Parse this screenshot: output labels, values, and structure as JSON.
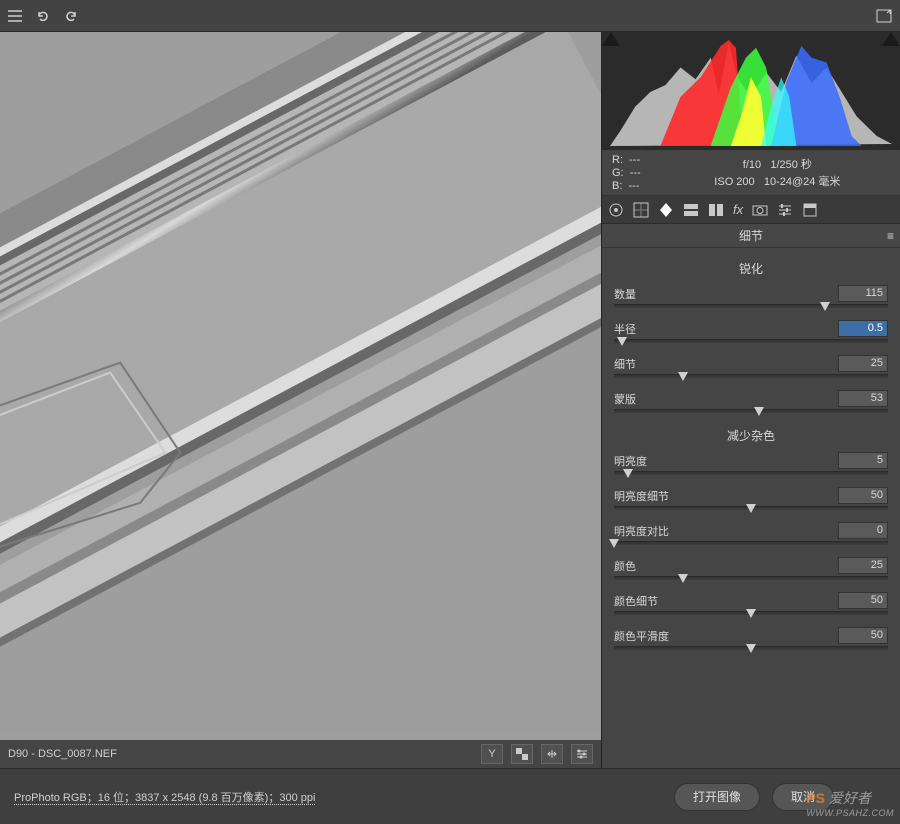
{
  "toolbar": {
    "icons": [
      "list-icon",
      "undo-icon",
      "redo-icon",
      "fullscreen-icon"
    ]
  },
  "preview": {
    "filename": "D90 -  DSC_0087.NEF"
  },
  "histogram": {
    "rgb": {
      "r": "---",
      "g": "---",
      "b": "---"
    },
    "exif": {
      "aperture": "f/10",
      "shutter": "1/250 秒",
      "iso": "ISO 200",
      "lens": "10-24@24 毫米"
    }
  },
  "tabs": [
    "aperture-icon",
    "grid-icon",
    "detail-icon",
    "split-tone-icon",
    "lens-icon",
    "fx-icon",
    "camera-icon",
    "sliders-icon",
    "presets-icon"
  ],
  "panel": {
    "title": "细节",
    "section1": "锐化",
    "section2": "减少杂色",
    "sliders": {
      "amount": {
        "label": "数量",
        "value": "115",
        "pos": 77
      },
      "radius": {
        "label": "半径",
        "value": "0.5",
        "pos": 3,
        "selected": true
      },
      "detail": {
        "label": "细节",
        "value": "25",
        "pos": 25
      },
      "masking": {
        "label": "蒙版",
        "value": "53",
        "pos": 53
      },
      "lum": {
        "label": "明亮度",
        "value": "5",
        "pos": 5
      },
      "lumDet": {
        "label": "明亮度细节",
        "value": "50",
        "pos": 50
      },
      "lumCon": {
        "label": "明亮度对比",
        "value": "0",
        "pos": 0
      },
      "col": {
        "label": "颜色",
        "value": "25",
        "pos": 25
      },
      "colDet": {
        "label": "颜色细节",
        "value": "50",
        "pos": 50
      },
      "colSmo": {
        "label": "颜色平滑度",
        "value": "50",
        "pos": 50
      }
    }
  },
  "footer": {
    "info": "ProPhoto RGB；16 位；3837 x 2548 (9.8 百万像素)；300 ppi",
    "open": "打开图像",
    "cancel": "取消"
  },
  "watermark": {
    "brand": "PS",
    "text": "爱好者",
    "url": "WWW.PSAHZ.COM"
  }
}
